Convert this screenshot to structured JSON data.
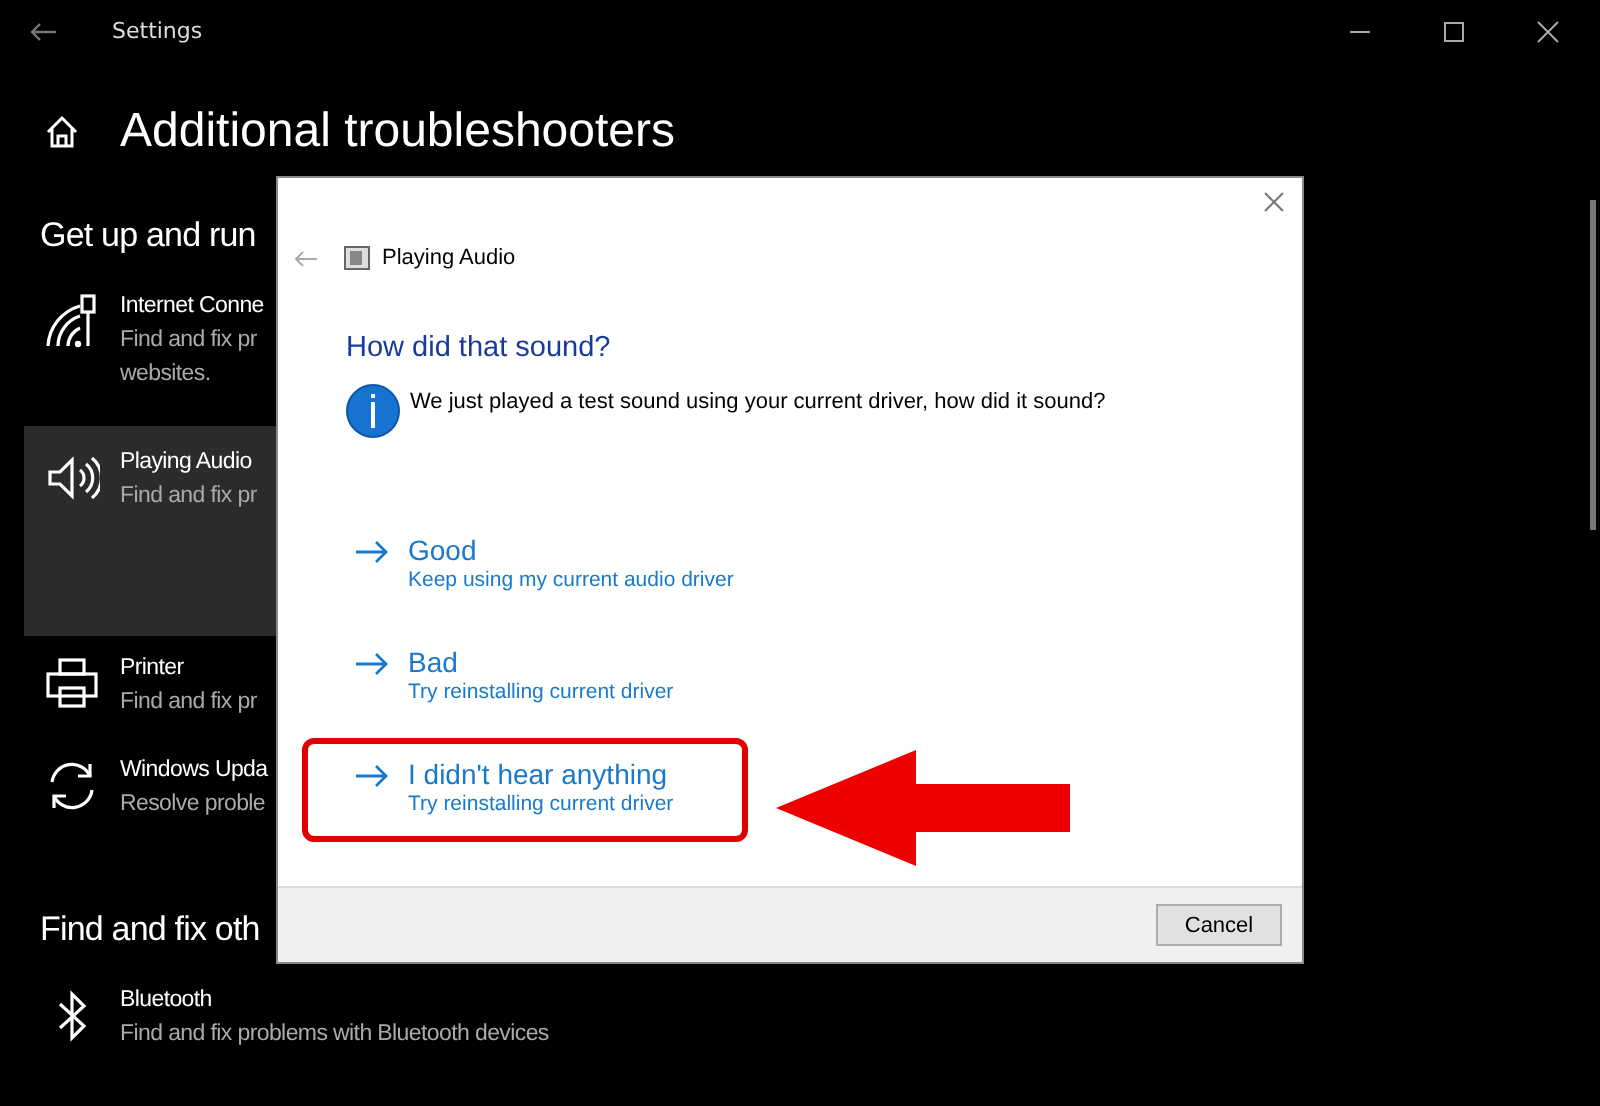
{
  "window": {
    "title": "Settings"
  },
  "page": {
    "title": "Additional troubleshooters",
    "sections": [
      {
        "heading": "Get up and run",
        "items": [
          {
            "kind": "network",
            "title": "Internet Conne",
            "description": [
              "Find and fix pr",
              "websites."
            ],
            "selected": false
          },
          {
            "kind": "audio",
            "title": "Playing Audio",
            "description": [
              "Find and fix pr"
            ],
            "selected": true
          },
          {
            "kind": "printer",
            "title": "Printer",
            "description": [
              "Find and fix pr"
            ],
            "selected": false
          },
          {
            "kind": "update",
            "title": "Windows Upda",
            "description": [
              "Resolve proble"
            ],
            "selected": false
          }
        ]
      },
      {
        "heading": "Find and fix oth",
        "items": [
          {
            "kind": "bluetooth",
            "title": "Bluetooth",
            "description": [
              "Find and fix problems with Bluetooth devices"
            ],
            "selected": false
          }
        ]
      }
    ]
  },
  "dialog": {
    "title": "Playing Audio",
    "heading": "How did that sound?",
    "message": "We just played a test sound using your current driver, how did it sound?",
    "options": [
      {
        "title": "Good",
        "subtitle": "Keep using my current audio driver",
        "highlighted": false
      },
      {
        "title": "Bad",
        "subtitle": "Try reinstalling current driver",
        "highlighted": false
      },
      {
        "title": "I didn't hear anything",
        "subtitle": "Try reinstalling current driver",
        "highlighted": true
      }
    ],
    "buttons": [
      "Cancel"
    ]
  }
}
